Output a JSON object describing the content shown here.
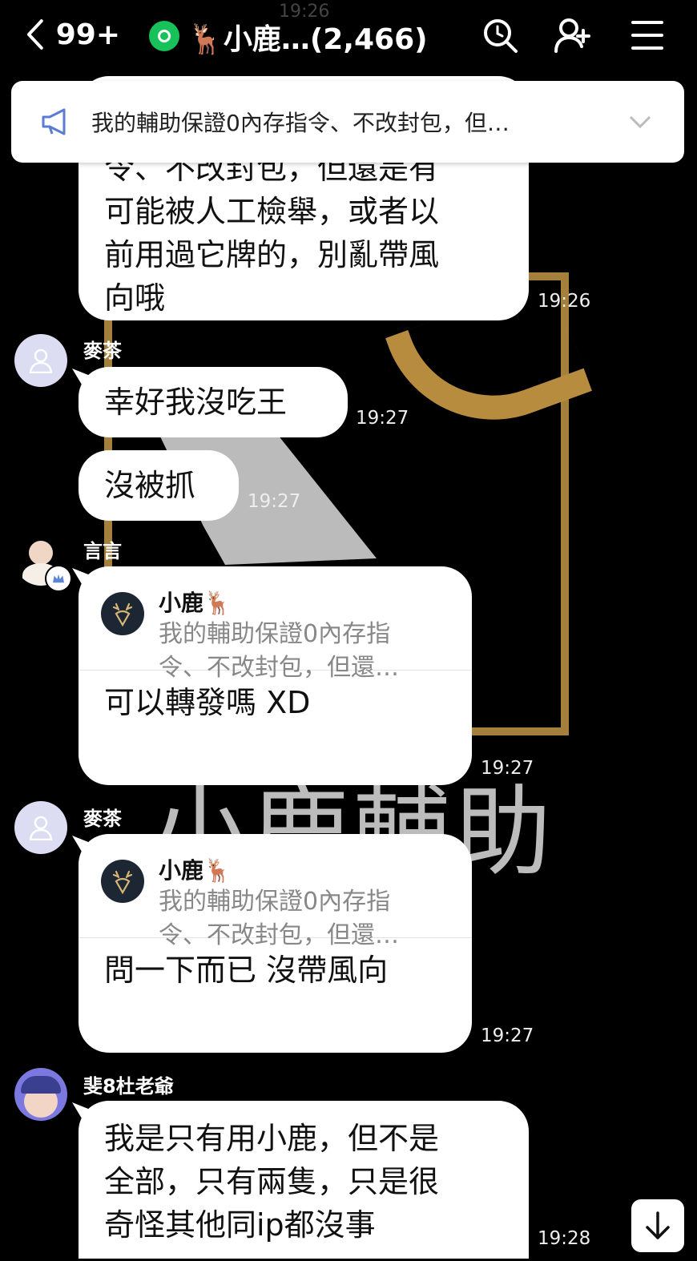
{
  "header": {
    "back_count": "99+",
    "title": "🦌小鹿…(2,466)",
    "faint_time": "19:26"
  },
  "announcement": {
    "text": "我的輔助保證0內存指令、不改封包，但…"
  },
  "messages": [
    {
      "id": "m1",
      "text": "令、不改封包，但還是有\n可能被人工檢舉，或者以\n前用過它牌的，別亂帶風\n向哦",
      "time": "19:26"
    },
    {
      "id": "m2",
      "sender": "麥茶",
      "text": "幸好我沒吃王",
      "time": "19:27"
    },
    {
      "id": "m3",
      "text": "沒被抓",
      "time": "19:27"
    },
    {
      "id": "m4",
      "sender": "言言",
      "reply": {
        "name": "小鹿🦌",
        "snippet": "我的輔助保證0內存指\n令、不改封包，但還…"
      },
      "text": "可以轉發嗎 XD",
      "time": "19:27"
    },
    {
      "id": "m5",
      "sender": "麥茶",
      "reply": {
        "name": "小鹿🦌",
        "snippet": "我的輔助保證0內存指\n令、不改封包，但還…"
      },
      "text": "問一下而已 沒帶風向",
      "time": "19:27"
    },
    {
      "id": "m6",
      "sender": "斐8杜老爺",
      "text": "我是只有用小鹿，但不是\n全部，只有兩隻，只是很\n奇怪其他同ip都沒事",
      "time": "19:28"
    }
  ],
  "background": {
    "watermark": "小鹿輔助"
  },
  "icons": [
    "chevron-left-icon",
    "open-chat-icon",
    "search-icon",
    "add-friend-icon",
    "menu-icon",
    "megaphone-icon",
    "chevron-down-icon",
    "user-icon",
    "deer-icon",
    "crown-icon",
    "arrow-down-icon"
  ],
  "colors": {
    "accent_green": "#19c15a",
    "announce_icon": "#5b7bd5",
    "frame_gold": "#a5803c"
  }
}
